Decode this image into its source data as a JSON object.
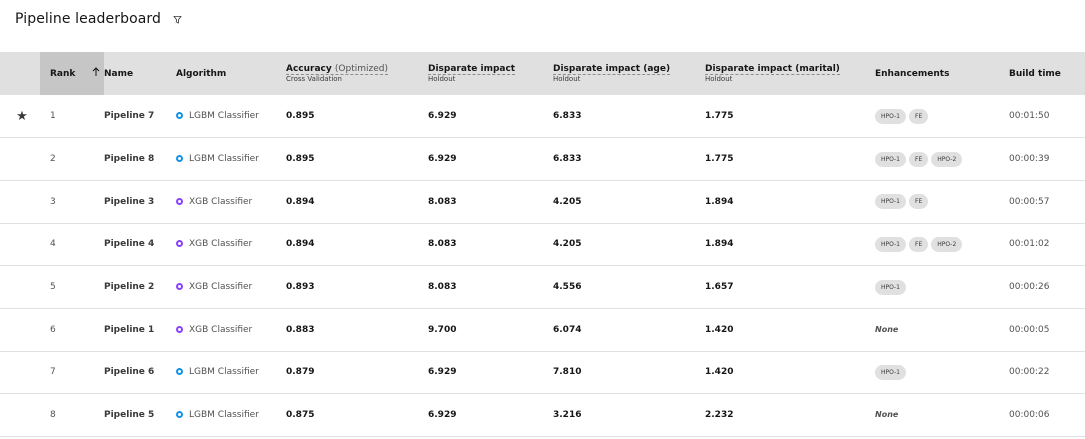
{
  "header": {
    "title": "Pipeline leaderboard",
    "filter_icon": "filter-icon"
  },
  "columns": {
    "rank": "Rank",
    "name": "Name",
    "algorithm": "Algorithm",
    "accuracy": "Accuracy",
    "accuracy_optimized": "(Optimized)",
    "accuracy_sub": "Cross Validation",
    "di": "Disparate impact",
    "di_sub": "Holdout",
    "di_age": "Disparate impact (age)",
    "di_age_sub": "Holdout",
    "di_marital": "Disparate impact (marital)",
    "di_marital_sub": "Holdout",
    "enhancements": "Enhancements",
    "build_time": "Build time"
  },
  "sort": {
    "column": "rank",
    "direction": "ascending",
    "icon": "arrow-up-icon"
  },
  "colors": {
    "lgbm": "#1192e8",
    "xgb": "#8a3ffc",
    "header_bg": "#e0e0e0"
  },
  "rows": [
    {
      "star": "★",
      "rank": "1",
      "name": "Pipeline 7",
      "algorithm": "LGBM Classifier",
      "accuracy": "0.895",
      "di": "6.929",
      "di_age": "6.833",
      "di_marital": "1.775",
      "enh": [
        "HPO-1",
        "FE"
      ],
      "none": "",
      "time": "00:01:50"
    },
    {
      "star": "",
      "rank": "2",
      "name": "Pipeline 8",
      "algorithm": "LGBM Classifier",
      "accuracy": "0.895",
      "di": "6.929",
      "di_age": "6.833",
      "di_marital": "1.775",
      "enh": [
        "HPO-1",
        "FE",
        "HPO-2"
      ],
      "none": "",
      "time": "00:00:39"
    },
    {
      "star": "",
      "rank": "3",
      "name": "Pipeline 3",
      "algorithm": "XGB Classifier",
      "accuracy": "0.894",
      "di": "8.083",
      "di_age": "4.205",
      "di_marital": "1.894",
      "enh": [
        "HPO-1",
        "FE"
      ],
      "none": "",
      "time": "00:00:57"
    },
    {
      "star": "",
      "rank": "4",
      "name": "Pipeline 4",
      "algorithm": "XGB Classifier",
      "accuracy": "0.894",
      "di": "8.083",
      "di_age": "4.205",
      "di_marital": "1.894",
      "enh": [
        "HPO-1",
        "FE",
        "HPO-2"
      ],
      "none": "",
      "time": "00:01:02"
    },
    {
      "star": "",
      "rank": "5",
      "name": "Pipeline 2",
      "algorithm": "XGB Classifier",
      "accuracy": "0.893",
      "di": "8.083",
      "di_age": "4.556",
      "di_marital": "1.657",
      "enh": [
        "HPO-1"
      ],
      "none": "",
      "time": "00:00:26"
    },
    {
      "star": "",
      "rank": "6",
      "name": "Pipeline 1",
      "algorithm": "XGB Classifier",
      "accuracy": "0.883",
      "di": "9.700",
      "di_age": "6.074",
      "di_marital": "1.420",
      "enh": [],
      "none": "None",
      "time": "00:00:05"
    },
    {
      "star": "",
      "rank": "7",
      "name": "Pipeline 6",
      "algorithm": "LGBM Classifier",
      "accuracy": "0.879",
      "di": "6.929",
      "di_age": "7.810",
      "di_marital": "1.420",
      "enh": [
        "HPO-1"
      ],
      "none": "",
      "time": "00:00:22"
    },
    {
      "star": "",
      "rank": "8",
      "name": "Pipeline 5",
      "algorithm": "LGBM Classifier",
      "accuracy": "0.875",
      "di": "6.929",
      "di_age": "3.216",
      "di_marital": "2.232",
      "enh": [],
      "none": "None",
      "time": "00:00:06"
    }
  ]
}
